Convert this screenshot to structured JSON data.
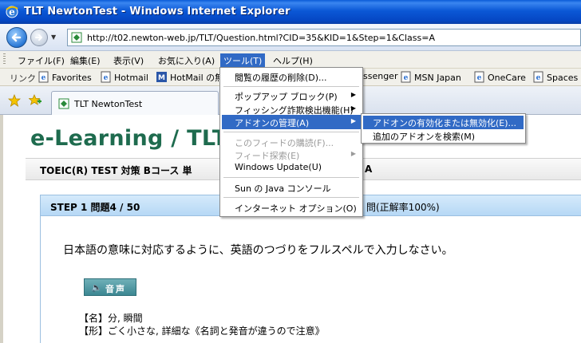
{
  "window": {
    "title": "TLT NewtonTest - Windows Internet Explorer"
  },
  "address": {
    "url": "http://t02.newton-web.jp/TLT/Question.html?CID=35&KID=1&Step=1&Class=A"
  },
  "menubar": [
    {
      "label": "ファイル(F)"
    },
    {
      "label": "編集(E)"
    },
    {
      "label": "表示(V)"
    },
    {
      "label": "お気に入り(A)"
    },
    {
      "label": "ツール(T)"
    },
    {
      "label": "ヘルプ(H)"
    }
  ],
  "links": {
    "label": "リンク",
    "items": [
      {
        "label": "Favorites"
      },
      {
        "label": "Hotmail"
      },
      {
        "label": "HotMail の無"
      },
      {
        "label": "ssenger"
      },
      {
        "label": "MSN Japan"
      },
      {
        "label": "OneCare"
      },
      {
        "label": "Spaces"
      }
    ]
  },
  "tab": {
    "label": "TLT NewtonTest"
  },
  "page": {
    "brand": "e-Learning / TLT",
    "course_left": "TOEIC(R) TEST 対策 Bコース 単",
    "course_right": "A",
    "step": "STEP 1  問題4 / 50",
    "rate": "問(正解率100%)",
    "instruction": "日本語の意味に対応するように、英語のつづりをフルスペルで入力しなさい。",
    "sound_label": "音声",
    "meaning_1": "【名】分, 瞬間",
    "meaning_2": "【形】ごく小さな, 詳細な《名詞と発音が違うので注意》"
  },
  "tools_menu": [
    {
      "label": "閲覧の履歴の削除(D)..."
    },
    {
      "label": "ポップアップ ブロック(P)"
    },
    {
      "label": "フィッシング詐欺検出機能(H)"
    },
    {
      "label": "アドオンの管理(A)"
    },
    {
      "label": "このフィードの購読(F)..."
    },
    {
      "label": "フィード探索(E)"
    },
    {
      "label": "Windows Update(U)"
    },
    {
      "label": "Sun の Java コンソール"
    },
    {
      "label": "インターネット オプション(O)"
    }
  ],
  "addon_submenu": [
    {
      "label": "アドオンの有効化または無効化(E)..."
    },
    {
      "label": "追加のアドオンを検索(M)"
    }
  ],
  "colors": {
    "accent": "#316ac5",
    "brand": "#1e6b4e",
    "titlebar": "#0a5bd8"
  }
}
